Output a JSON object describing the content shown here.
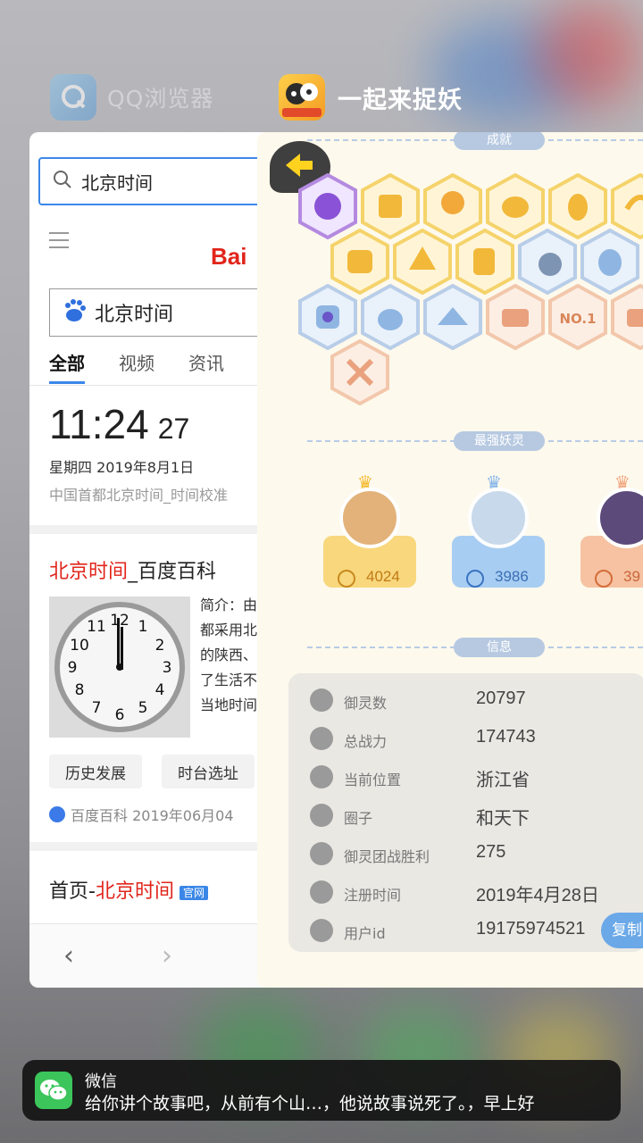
{
  "switcher": {
    "qq_app_name": "QQ浏览器",
    "game_app_name": "一起来捉妖"
  },
  "browser": {
    "search_query": "北京时间",
    "baidu_logo": "Bai",
    "baidu_search_query": "北京时间",
    "tabs": [
      "全部",
      "视频",
      "资讯"
    ],
    "time_main": "11:24",
    "time_seconds": "27",
    "date_line": "星期四 2019年8月1日",
    "date_sub": "中国首都北京时间_时间校准",
    "baike_title_red": "北京时间",
    "baike_title_rest": "_百度百科",
    "intro_lines": [
      "简介：由",
      "都采用北",
      "的陕西、",
      "了生活不",
      "当地时间"
    ],
    "chips": [
      "历史发展",
      "时台选址"
    ],
    "source": "百度百科  2019年06月04",
    "home_title_prefix": "首页-",
    "home_title_red": "北京时间",
    "home_badge": "官网",
    "nav_back": "‹",
    "nav_forward": "›"
  },
  "game": {
    "sections": {
      "achievements": "成就",
      "strongest": "最强妖灵",
      "info": "信息"
    },
    "heroes": [
      {
        "score": "4024",
        "color": "#f3c25b"
      },
      {
        "score": "3986",
        "color": "#7fb3ea"
      },
      {
        "score": "39",
        "color": "#f0a27a"
      }
    ],
    "info_rows": [
      {
        "label": "御灵数",
        "value": "20797"
      },
      {
        "label": "总战力",
        "value": "174743"
      },
      {
        "label": "当前位置",
        "value": "浙江省"
      },
      {
        "label": "圈子",
        "value": "和天下"
      },
      {
        "label": "御灵团战胜利",
        "value": "275"
      },
      {
        "label": "注册时间",
        "value": "2019年4月28日"
      },
      {
        "label": "用户id",
        "value": "19175974521"
      }
    ],
    "copy_button": "复制",
    "badge_no1": "NO.1"
  },
  "notification": {
    "app": "微信",
    "message": "给你讲个故事吧，从前有个山…，他说故事说死了。，早上好"
  }
}
